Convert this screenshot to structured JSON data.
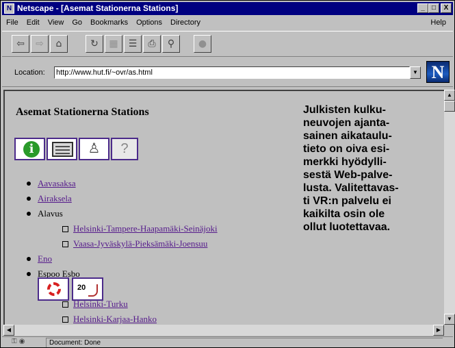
{
  "window": {
    "title": "Netscape - [Asemat Stationerna Stations]",
    "buttons": [
      "_",
      "□",
      "X"
    ]
  },
  "menu": {
    "items": [
      "File",
      "Edit",
      "View",
      "Go",
      "Bookmarks",
      "Options",
      "Directory"
    ],
    "help": "Help"
  },
  "toolbar": {
    "icons": [
      "back-icon",
      "forward-icon",
      "home-icon",
      "reload-icon",
      "images-icon",
      "open-icon",
      "print-icon",
      "find-icon",
      "stop-icon"
    ]
  },
  "location": {
    "label": "Location:",
    "url": "http://www.hut.fi/~ovr/as.html",
    "logo_letter": "N"
  },
  "page": {
    "title": "Asemat Stationerna Stations",
    "stations": [
      {
        "name": "Aavasaksa"
      },
      {
        "name": "Airaksela"
      },
      {
        "name": "Alavus"
      },
      {
        "name": "Helsinki-Tampere-Haapamäki-Seinäjoki"
      },
      {
        "name": "Vaasa-Jyväskylä-Pieksämäki-Joensuu"
      },
      {
        "name": "Eno"
      },
      {
        "name": "Espoo Esbo"
      },
      {
        "name": "Helsinki-Turku"
      },
      {
        "name": "Helsinki-Karjaa-Hanko"
      }
    ],
    "clock_number": "20"
  },
  "side_note": "Julkisten kulku-\nneuvojen ajanta-\nsainen aikataulu-\ntieto on oiva esi-\nmerkki hyödylli-\nsestä Web-palve-\nlusta. Valitettavas-\nti VR:n palvelu ei\nkaikilta osin ole\nollut luotettavaa.",
  "status": {
    "text": "Document: Done"
  },
  "colors": {
    "titlebar": "#000080",
    "chrome": "#c0c0c0",
    "visited_link": "#551a8b"
  }
}
